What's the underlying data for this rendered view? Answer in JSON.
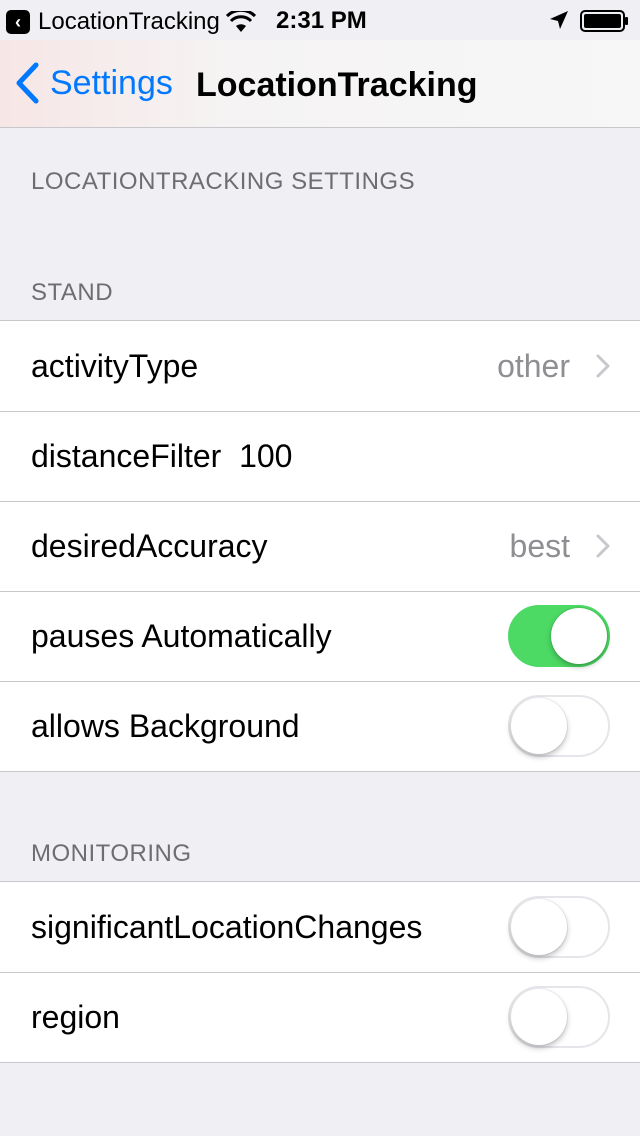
{
  "status_bar": {
    "back_app_label": "LocationTracking",
    "time": "2:31 PM"
  },
  "nav": {
    "back_label": "Settings",
    "title": "LocationTracking"
  },
  "page_header": "LOCATIONTRACKING SETTINGS",
  "sections": {
    "stand": {
      "header": "STAND",
      "rows": [
        {
          "label": "activityType",
          "detail": "other"
        },
        {
          "label": "distanceFilter  100"
        },
        {
          "label": "desiredAccuracy",
          "detail": "best"
        },
        {
          "label": "pauses Automatically",
          "toggle_on": true
        },
        {
          "label": "allows Background",
          "toggle_on": false
        }
      ]
    },
    "monitoring": {
      "header": "MONITORING",
      "rows": [
        {
          "label": "significantLocationChanges",
          "toggle_on": false
        },
        {
          "label": "region",
          "toggle_on": false
        }
      ]
    }
  },
  "colors": {
    "tint": "#0079ff",
    "toggle_on": "#4cd964",
    "secondary_text": "#8e8e93",
    "group_header": "#6d6d72",
    "background": "#efeff4"
  }
}
